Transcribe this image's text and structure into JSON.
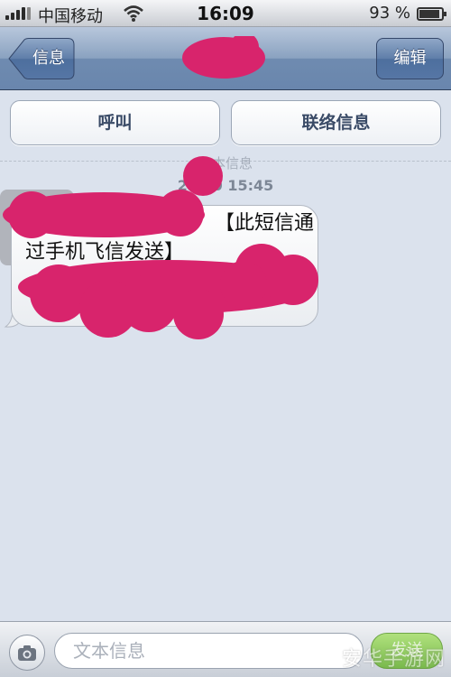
{
  "status_bar": {
    "carrier": "中国移动",
    "time": "16:09",
    "battery_percent_text": "93 %",
    "battery_level": 0.93
  },
  "nav": {
    "back_label": "信息",
    "edit_label": "编辑",
    "title_redacted": true
  },
  "actions": {
    "call_label": "呼叫",
    "contact_label": "联络信息"
  },
  "conversation": {
    "type_label": "文本信息",
    "timestamp": "20   30 15:45",
    "messages": [
      {
        "text_line1": "【此短信通",
        "text_line2": "过手机飞信发送】",
        "redacted_parts": true
      }
    ]
  },
  "input_bar": {
    "placeholder": "文本信息",
    "send_label": "发送"
  },
  "watermark": "安华手游网",
  "colors": {
    "nav_blue": "#6986ad",
    "redaction_pink": "#d8246c",
    "background": "#dbe2ed",
    "send_green": "#6bb534"
  },
  "icons": [
    "signal-icon",
    "wifi-icon",
    "battery-icon",
    "back-chevron-icon",
    "camera-icon"
  ]
}
